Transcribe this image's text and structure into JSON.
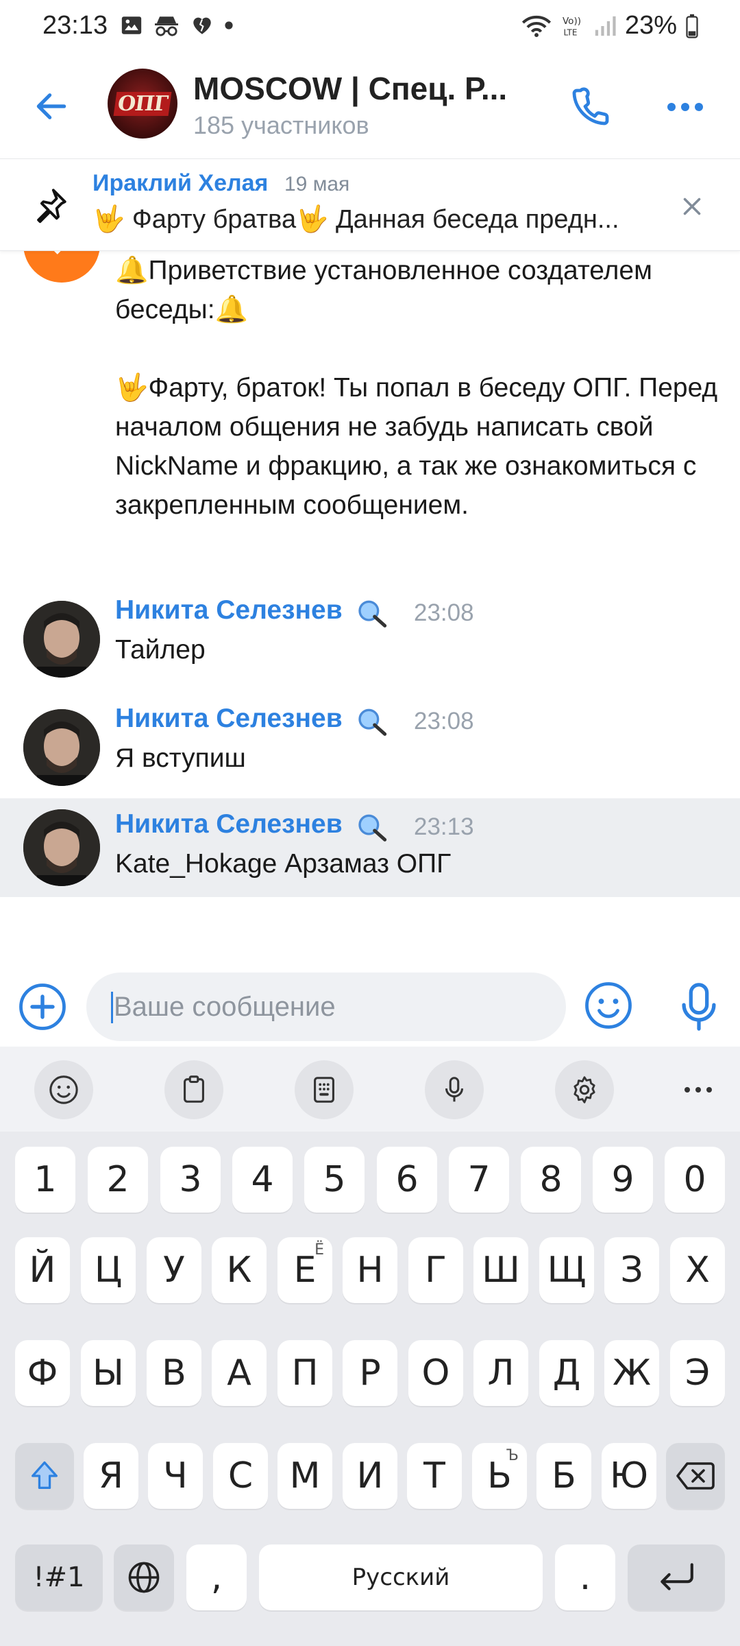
{
  "status_bar": {
    "time": "23:13",
    "battery": "23%",
    "network_label": "Vo)) LTE"
  },
  "header": {
    "avatar_text": "ОПГ",
    "title": "MOSCOW | Спец. Р...",
    "subtitle": "185 участников"
  },
  "pinned": {
    "author": "Ираклий Хелая",
    "date": "19 мая",
    "text": "🤟 Фарту братва🤟  Данная беседа предн..."
  },
  "system_message": {
    "text": "🔔Приветствие установленное создателем беседы:🔔\n\n🤟Фарту, браток! Ты попал в беседу ОПГ. Перед началом общения не забудь написать свой NickName и фракцию, а так же ознакомиться с закрепленным сообщением."
  },
  "messages": [
    {
      "author": "Никита Селезнев",
      "time": "23:08",
      "text": "Тайлер"
    },
    {
      "author": "Никита Селезнев",
      "time": "23:08",
      "text": "Я вступиш"
    },
    {
      "author": "Никита Селезнев",
      "time": "23:13",
      "text": "Kate_Hokage Арзамаз ОПГ"
    }
  ],
  "composer": {
    "placeholder": "Ваше сообщение"
  },
  "keyboard": {
    "row_numbers": [
      "1",
      "2",
      "3",
      "4",
      "5",
      "6",
      "7",
      "8",
      "9",
      "0"
    ],
    "row1": [
      "Й",
      "Ц",
      "У",
      "К",
      "Е",
      "Н",
      "Г",
      "Ш",
      "Щ",
      "З",
      "Х"
    ],
    "row1_alt_e": "Ё",
    "row2": [
      "Ф",
      "Ы",
      "В",
      "А",
      "П",
      "Р",
      "О",
      "Л",
      "Д",
      "Ж",
      "Э"
    ],
    "row3": [
      "Я",
      "Ч",
      "С",
      "М",
      "И",
      "Т",
      "Ь",
      "Б",
      "Ю"
    ],
    "row3_alt_soft": "Ъ",
    "symbols_key": "!#1",
    "comma_key": ",",
    "space_label": "Русский",
    "period_key": "."
  },
  "colors": {
    "accent": "#2d81e0",
    "secondary_text": "#99a2ad",
    "selected_row": "#eceef1",
    "system_avatar": "#ff7a1a"
  }
}
